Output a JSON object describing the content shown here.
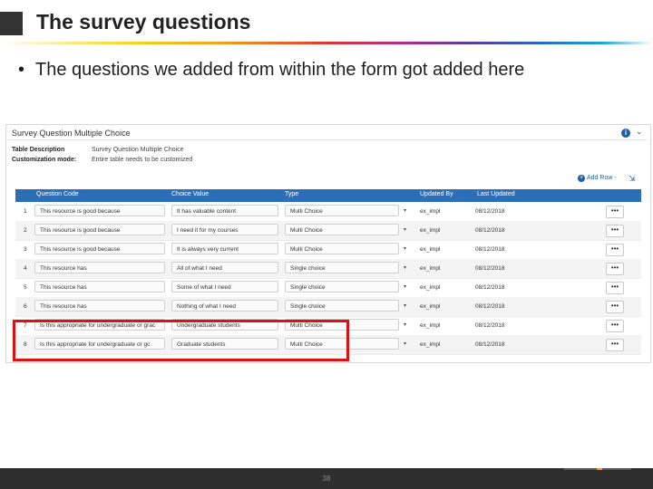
{
  "slide": {
    "title": "The survey questions",
    "bullet": "The questions we added from within the form got added here",
    "page_number": "38"
  },
  "form": {
    "title": "Survey Question Multiple Choice",
    "meta": [
      {
        "label": "Table Description",
        "value": "Survey Question Multiple Choice"
      },
      {
        "label": "Customization mode:",
        "value": "Entire table needs to be customized"
      }
    ],
    "add_row_label": "Add Row -",
    "icons": {
      "info": "info-icon",
      "collapse": "chevron-down-icon",
      "add": "plus-icon",
      "export": "export-icon"
    },
    "columns": [
      "Question Code",
      "Choice Value",
      "Type",
      "Updated By",
      "Last Updated"
    ],
    "rows": [
      {
        "num": "1",
        "code": "This resource is good because",
        "value": "It has valuable content",
        "type": "Multi Choice",
        "updated_by": "ex_impl",
        "date": "08/12/2018"
      },
      {
        "num": "2",
        "code": "This resource is good because",
        "value": "I need it for my courses",
        "type": "Multi Choice",
        "updated_by": "ex_impl",
        "date": "08/12/2018"
      },
      {
        "num": "3",
        "code": "This resource is good because",
        "value": "It is always very current",
        "type": "Multi Choice",
        "updated_by": "ex_impl",
        "date": "08/12/2018"
      },
      {
        "num": "4",
        "code": "This resource has",
        "value": "All of what I need",
        "type": "Single choice",
        "updated_by": "ex_impl",
        "date": "08/12/2018"
      },
      {
        "num": "5",
        "code": "This resource has",
        "value": "Some of what I need",
        "type": "Single choice",
        "updated_by": "ex_impl",
        "date": "08/12/2018"
      },
      {
        "num": "6",
        "code": "This resource has",
        "value": "Nothing of what I need",
        "type": "Single choice",
        "updated_by": "ex_impl",
        "date": "08/12/2018"
      },
      {
        "num": "7",
        "code": "Is this appropriate for undergraduate or grac",
        "value": "Undergraduate students",
        "type": "Multi Choice",
        "updated_by": "ex_impl",
        "date": "08/12/2018"
      },
      {
        "num": "8",
        "code": "Is this appropriate for undergraduate or gc",
        "value": "Graduate students",
        "type": "Multi Choice",
        "updated_by": "ex_impl",
        "date": "08/12/2018"
      }
    ],
    "more_button_label": "•••",
    "dropdown_glyph": "▾"
  },
  "colors": {
    "header": "#2c6fb7",
    "highlight": "#e01010",
    "footer": "#2e2e2e"
  }
}
